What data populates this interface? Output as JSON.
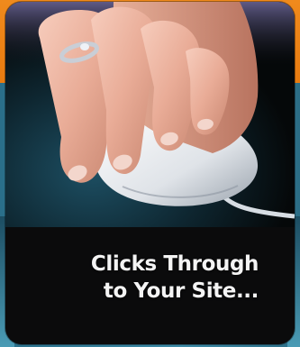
{
  "banner": {
    "caption_line1": "Clicks Through",
    "caption_line2": "to Your Site...",
    "image_subject": "hand-on-computer-mouse",
    "colors": {
      "accent_orange": "#f08a1c",
      "card_background": "#0b0b0c",
      "edge_teal": "#3d8aa6",
      "caption_text": "#f4f4f4"
    }
  }
}
